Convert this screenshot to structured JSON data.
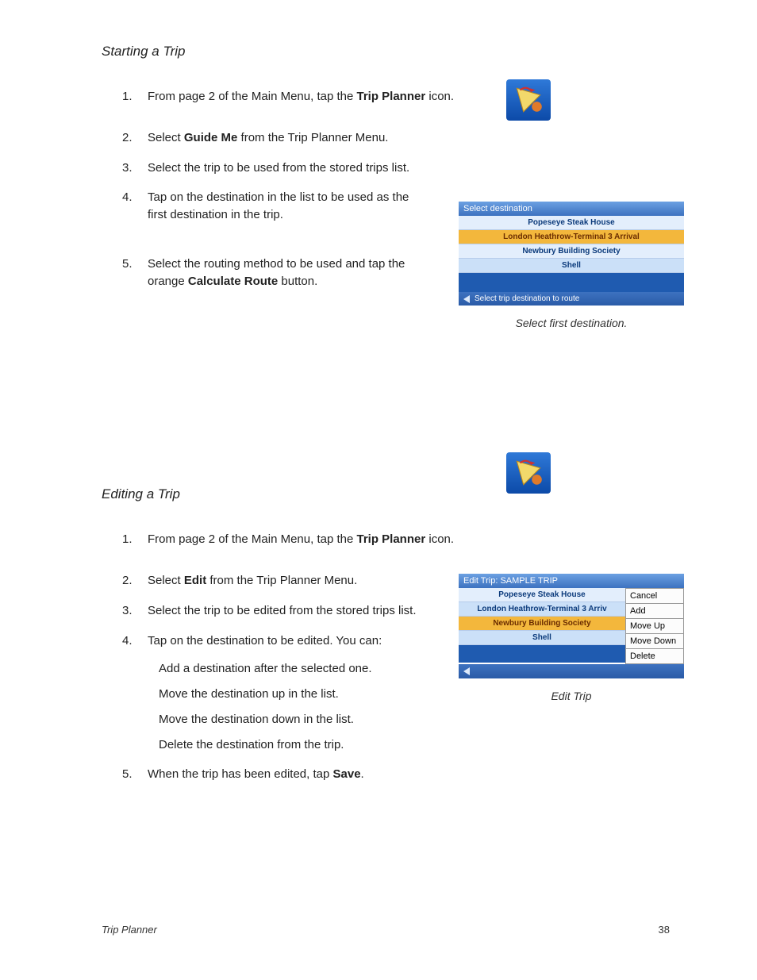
{
  "section1": {
    "title": "Starting a Trip",
    "steps": [
      {
        "n": "1.",
        "pre": "From page 2 of the Main Menu, tap the ",
        "bold": "Trip Planner",
        "post": " icon."
      },
      {
        "n": "2.",
        "pre": "Select ",
        "bold": "Guide Me",
        "post": " from the Trip Planner Menu."
      },
      {
        "n": "3.",
        "text": "Select the trip to be used from the stored trips list."
      },
      {
        "n": "4.",
        "text": "Tap on the destination in the list to be used as the first destination in the trip."
      },
      {
        "n": "5.",
        "pre": "Select the routing method to be used and tap the orange ",
        "bold": "Calculate Route",
        "post": " button."
      }
    ]
  },
  "section2": {
    "title": "Editing a Trip",
    "steps": [
      {
        "n": "1.",
        "pre": "From page 2 of the Main Menu, tap the ",
        "bold": "Trip Planner",
        "post": " icon."
      },
      {
        "n": "2.",
        "pre": "Select ",
        "bold": "Edit",
        "post": " from the Trip Planner Menu."
      },
      {
        "n": "3.",
        "text": "Select the trip to be edited from the stored trips list."
      },
      {
        "n": "4.",
        "text": "Tap on the destination to be edited. You can:",
        "subs": [
          "Add a destination after the selected one.",
          "Move the destination up in the list.",
          "Move the destination down in the list.",
          "Delete the destination from the trip."
        ]
      },
      {
        "n": "5.",
        "pre": "When the trip has been edited, tap ",
        "bold": "Save",
        "post": "."
      }
    ]
  },
  "shot1": {
    "header": "Select destination",
    "rows": [
      "Popeseye Steak House",
      "London Heathrow-Terminal 3 Arrival",
      "Newbury Building Society",
      "Shell"
    ],
    "footer": "Select trip destination to route",
    "caption": "Select first destination."
  },
  "shot2": {
    "header": "Edit Trip: SAMPLE TRIP",
    "rows": [
      "Popeseye Steak House",
      "London Heathrow-Terminal 3 Arriv",
      "Newbury Building Society",
      "Shell"
    ],
    "menu": [
      "Cancel",
      "Add",
      "Move Up",
      "Move Down",
      "Delete"
    ],
    "caption": "Edit Trip"
  },
  "footer": {
    "title": "Trip Planner",
    "page": "38"
  }
}
